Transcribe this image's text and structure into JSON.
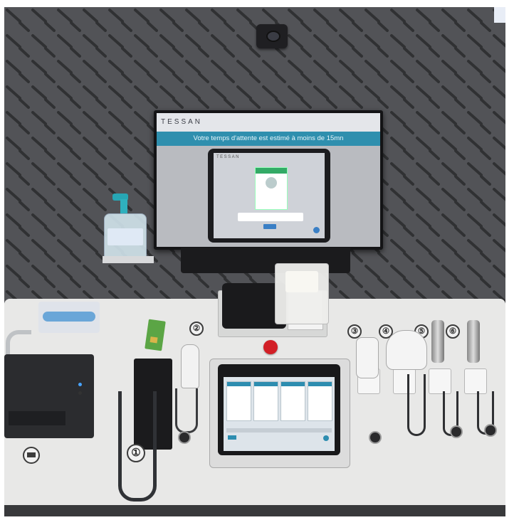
{
  "photo": {
    "subject": "",
    "monitor": {
      "brand": "TESSAN",
      "banner_text": "Votre temps d'attente est estimé à moins de 15mn",
      "tablet_brand": "TESSAN"
    },
    "instrument_labels": [
      "①",
      "②",
      "③",
      "④",
      "⑤",
      "⑥"
    ],
    "colors": {
      "wall": "#4f5053",
      "desk": "#e8e8e7",
      "banner": "#2f8fae",
      "alarm_button": "#d21f26"
    },
    "icons": [
      "webcam-icon",
      "printer-icon"
    ]
  }
}
